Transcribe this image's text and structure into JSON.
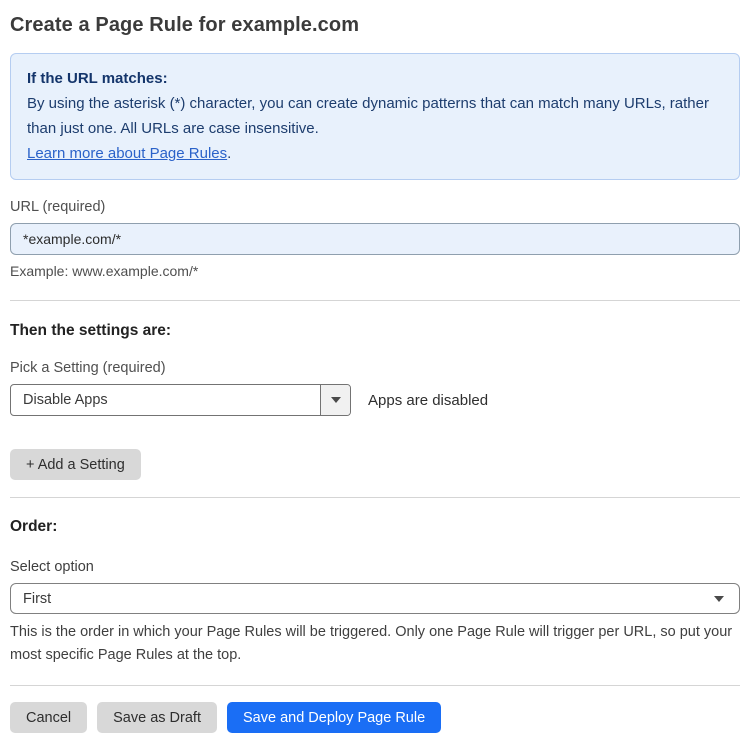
{
  "page": {
    "title": "Create a Page Rule for example.com"
  },
  "info_box": {
    "heading": "If the URL matches:",
    "body": "By using the asterisk (*) character, you can create dynamic patterns that can match many URLs, rather than just one. All URLs are case insensitive.",
    "link_label": "Learn more about Page Rules",
    "link_suffix": "."
  },
  "url_field": {
    "label": "URL (required)",
    "value": "*example.com/*",
    "example": "Example: www.example.com/*"
  },
  "settings": {
    "heading": "Then the settings are:",
    "pick_label": "Pick a Setting (required)",
    "selected_option": "Disable Apps",
    "status_text": "Apps are disabled",
    "add_button_label": "+ Add a Setting"
  },
  "order": {
    "heading": "Order:",
    "label": "Select option",
    "selected_option": "First",
    "help_text": "This is the order in which your Page Rules will be triggered. Only one Page Rule will trigger per URL, so put your most specific Page Rules at the top."
  },
  "footer": {
    "cancel_label": "Cancel",
    "save_draft_label": "Save as Draft",
    "save_deploy_label": "Save and Deploy Page Rule"
  },
  "colors": {
    "accent_blue": "#1a6ef5",
    "info_background": "#e8f1fc",
    "info_border": "#b5cdf1",
    "info_text": "#1d3d6e",
    "link_blue": "#2a62c9",
    "input_background": "#e9f1fc",
    "button_gray": "#d8d8d8"
  }
}
